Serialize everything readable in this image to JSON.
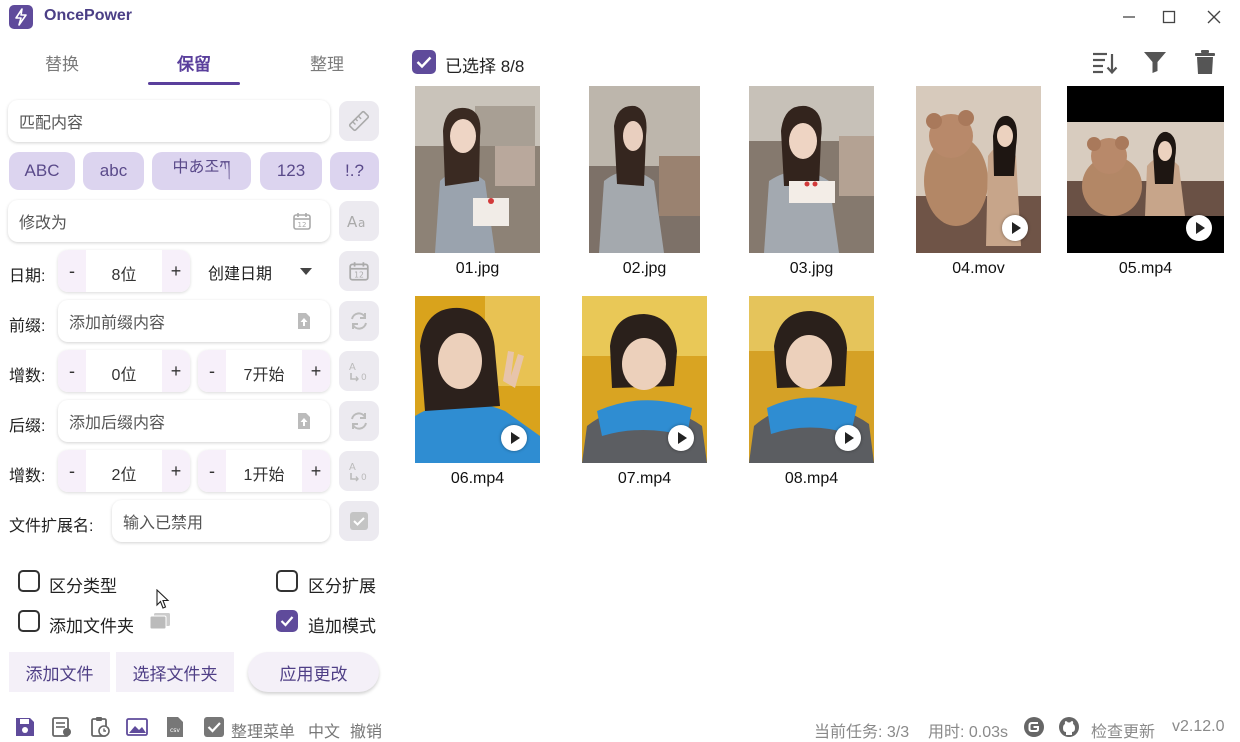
{
  "app": {
    "title": "OncePower"
  },
  "tabs": [
    {
      "label": "替换",
      "active": false
    },
    {
      "label": "保留",
      "active": true
    },
    {
      "label": "整理",
      "active": false
    }
  ],
  "form": {
    "match_placeholder": "匹配内容",
    "chips": [
      "ABC",
      "abc",
      "中あ조ཀ",
      "123",
      "!.?"
    ],
    "modify_placeholder": "修改为",
    "date": {
      "label": "日期:",
      "digits": "8位",
      "type": "创建日期"
    },
    "prefix": {
      "label": "前缀:",
      "placeholder": "添加前缀内容"
    },
    "increment1": {
      "label": "增数:",
      "digits": "0位",
      "start": "7开始"
    },
    "suffix": {
      "label": "后缀:",
      "placeholder": "添加后缀内容"
    },
    "increment2": {
      "label": "增数:",
      "digits": "2位",
      "start": "1开始"
    },
    "extension": {
      "label": "文件扩展名:",
      "placeholder": "输入已禁用"
    },
    "minus": "-",
    "plus": "+"
  },
  "options": [
    {
      "label": "区分类型",
      "checked": false
    },
    {
      "label": "区分扩展",
      "checked": false
    },
    {
      "label": "添加文件夹",
      "checked": false
    },
    {
      "label": "追加模式",
      "checked": true
    }
  ],
  "buttons": {
    "add_files": "添加文件",
    "select_folder": "选择文件夹",
    "apply": "应用更改"
  },
  "selection": {
    "label": "已选择 8/8"
  },
  "files": [
    {
      "name": "01.jpg",
      "video": false,
      "scene": "kitchen"
    },
    {
      "name": "02.jpg",
      "video": false,
      "scene": "kitchen"
    },
    {
      "name": "03.jpg",
      "video": false,
      "scene": "kitchen"
    },
    {
      "name": "04.mov",
      "video": true,
      "scene": "teddy"
    },
    {
      "name": "05.mp4",
      "video": true,
      "scene": "teddy-wide"
    },
    {
      "name": "06.mp4",
      "video": true,
      "scene": "autumn"
    },
    {
      "name": "07.mp4",
      "video": true,
      "scene": "autumn"
    },
    {
      "name": "08.mp4",
      "video": true,
      "scene": "autumn"
    }
  ],
  "statusbar": {
    "menu_label": "整理菜单",
    "language": "中文",
    "undo": "撤销",
    "tasks": "当前任务: 3/3",
    "time": "用时: 0.03s",
    "check_update": "检查更新",
    "version": "v2.12.0"
  },
  "colors": {
    "accent": "#5f4b9b",
    "chip": "#dcd4ef",
    "tab_active": "#5a3f9c"
  }
}
